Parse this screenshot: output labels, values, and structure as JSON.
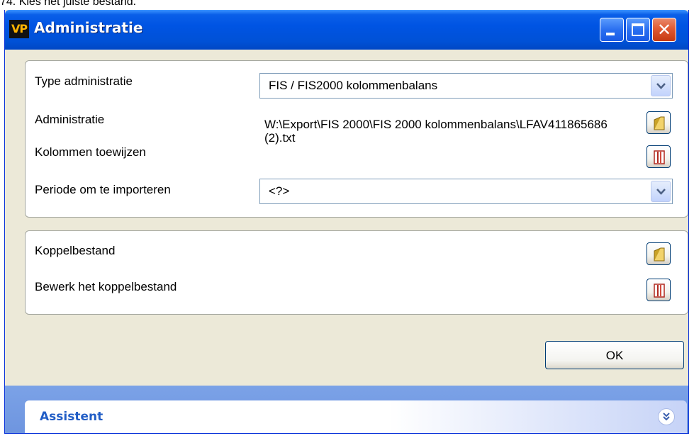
{
  "caption": "74. Kies het juiste bestand.",
  "window": {
    "title": "Administratie",
    "app_icon_text": "VP",
    "controls": {
      "minimize": "minimize",
      "maximize": "maximize",
      "close": "close"
    }
  },
  "panel1": {
    "type_label": "Type administratie",
    "type_value": "FIS / FIS2000 kolommenbalans",
    "administratie_label": "Administratie",
    "administratie_path": "W:\\Export\\FIS 2000\\FIS 2000 kolommenbalans\\LFAV411865686 (2).txt",
    "kolommen_label": "Kolommen toewijzen",
    "periode_label": "Periode om te importeren",
    "periode_value": "<?>"
  },
  "panel2": {
    "koppel_label": "Koppelbestand",
    "bewerk_label": "Bewerk het koppelbestand"
  },
  "ok_label": "OK",
  "assistent": {
    "title": "Assistent"
  },
  "colors": {
    "titlebar": "#0054e3",
    "window_bg": "#ece9d8",
    "assist_text": "#215dc6",
    "close_red": "#e05a33"
  }
}
